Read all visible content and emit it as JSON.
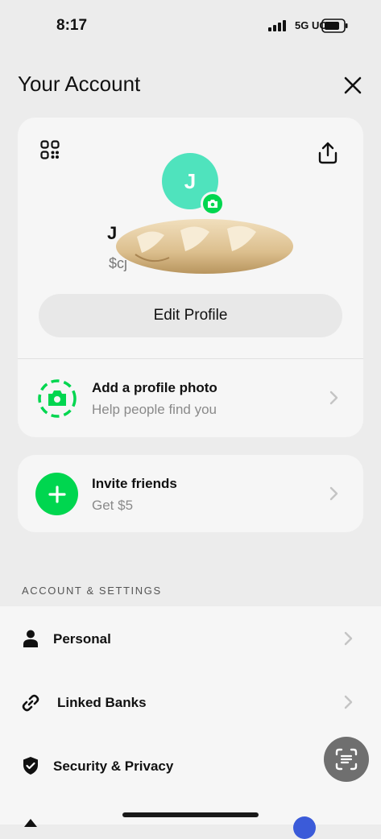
{
  "status_bar": {
    "time": "8:17",
    "network": "5G UC"
  },
  "header": {
    "title": "Your Account"
  },
  "profile": {
    "avatar_initial": "J",
    "name_visible": "J",
    "cashtag_visible": "$cj",
    "edit_label": "Edit Profile",
    "photo_prompt": {
      "title": "Add a profile photo",
      "subtitle": "Help people find you"
    }
  },
  "invite": {
    "title": "Invite friends",
    "subtitle": "Get $5"
  },
  "settings": {
    "section_label": "ACCOUNT & SETTINGS",
    "items": [
      {
        "label": "Personal",
        "icon": "person-icon"
      },
      {
        "label": "Linked Banks",
        "icon": "link-icon"
      },
      {
        "label": "Security & Privacy",
        "icon": "shield-icon"
      }
    ]
  },
  "colors": {
    "accent": "#00d64f",
    "avatar_bg": "#4fe3bd",
    "card_bg": "#f6f6f6",
    "page_bg": "#ececec"
  }
}
